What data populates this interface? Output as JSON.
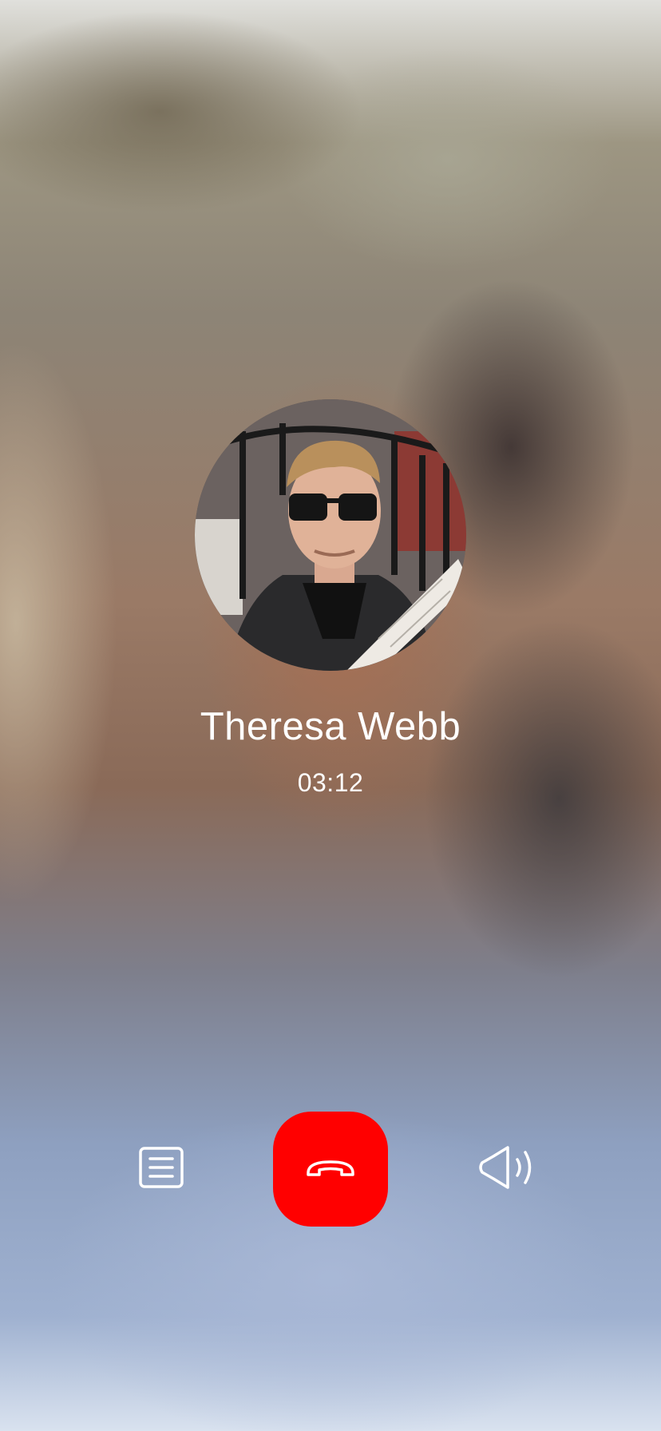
{
  "call": {
    "caller_name": "Theresa Webb",
    "duration": "03:12"
  },
  "controls": [
    {
      "id": "notes",
      "icon": "notes-icon"
    },
    {
      "id": "end-call",
      "icon": "phone-hangup-icon",
      "color": "#ff0000"
    },
    {
      "id": "speaker",
      "icon": "speaker-icon"
    }
  ]
}
